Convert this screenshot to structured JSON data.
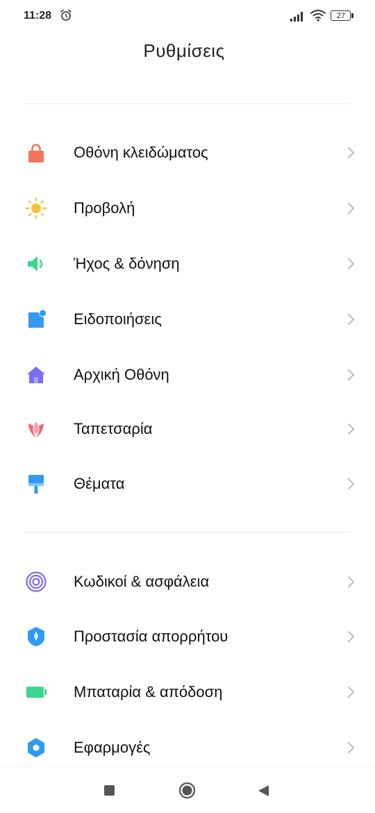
{
  "status_bar": {
    "time": "11:28",
    "battery": "27",
    "icons": [
      "alarm-icon",
      "signal-icon",
      "wifi-icon",
      "battery-icon"
    ]
  },
  "page": {
    "title": "Ρυθμίσεις"
  },
  "groups": [
    {
      "items": [
        {
          "label": "Οθόνη κλειδώματος",
          "icon": "lock-icon",
          "color": "#F4735E"
        },
        {
          "label": "Προβολή",
          "icon": "sun-icon",
          "color": "#F5C33B"
        },
        {
          "label": "Ήχος & δόνηση",
          "icon": "speaker-icon",
          "color": "#3DD68C"
        },
        {
          "label": "Ειδοποιήσεις",
          "icon": "notification-icon",
          "color": "#2F9BF2"
        },
        {
          "label": "Αρχική Οθόνη",
          "icon": "home-icon",
          "color": "#7B6CF2"
        },
        {
          "label": "Ταπετσαρία",
          "icon": "tulip-icon",
          "color": "#F2627A"
        },
        {
          "label": "Θέματα",
          "icon": "paint-roller-icon",
          "color": "#2F9BF2"
        }
      ]
    },
    {
      "items": [
        {
          "label": "Κωδικοί & ασφάλεια",
          "icon": "fingerprint-icon",
          "color": "#7B6CF2"
        },
        {
          "label": "Προστασία απορρήτου",
          "icon": "privacy-shield-icon",
          "color": "#2F9BF2"
        },
        {
          "label": "Μπαταρία & απόδοση",
          "icon": "battery-performance-icon",
          "color": "#3DD68C"
        },
        {
          "label": "Εφαρμογές",
          "icon": "gear-icon",
          "color": "#2F9BF2"
        }
      ]
    }
  ],
  "nav_bar": {
    "icons": [
      "recent-apps-icon",
      "home-button-icon",
      "back-icon"
    ]
  }
}
